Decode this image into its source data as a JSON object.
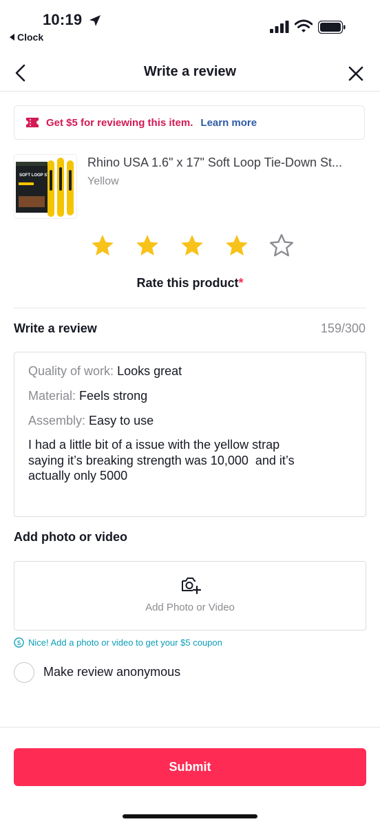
{
  "status_bar": {
    "time": "10:19",
    "back_app": "Clock"
  },
  "header": {
    "title": "Write a review"
  },
  "promo": {
    "text": "Get $5 for reviewing this item.",
    "link": "Learn more"
  },
  "product": {
    "title": "Rhino USA 1.6\" x 17\" Soft Loop Tie-Down St...",
    "variant": "Yellow",
    "thumb_text": "SOFT LOOP STRAPS"
  },
  "rating": {
    "value": 4,
    "max": 5,
    "label": "Rate this product",
    "required_mark": "*"
  },
  "review": {
    "label": "Write a review",
    "count": "159/300",
    "fields": [
      {
        "key": "Quality of work:",
        "value": "Looks great"
      },
      {
        "key": "Material:",
        "value": "Feels strong"
      },
      {
        "key": "Assembly:",
        "value": "Easy to use"
      }
    ],
    "body": "I had a little bit of a issue with the yellow strap\nsaying it’s breaking strength was 10,000  and it’s\nactually only 5000"
  },
  "media": {
    "label": "Add photo or video",
    "button_text": "Add Photo or Video"
  },
  "coupon_hint": "Nice! Add a photo or video to get your $5 coupon",
  "anonymous": {
    "label": "Make review anonymous",
    "checked": false
  },
  "submit": {
    "label": "Submit"
  },
  "colors": {
    "accent": "#fe2c55",
    "promo_text": "#d21a55",
    "link": "#2d5ba6",
    "hint": "#0a9db7",
    "star": "#f7c21a"
  }
}
